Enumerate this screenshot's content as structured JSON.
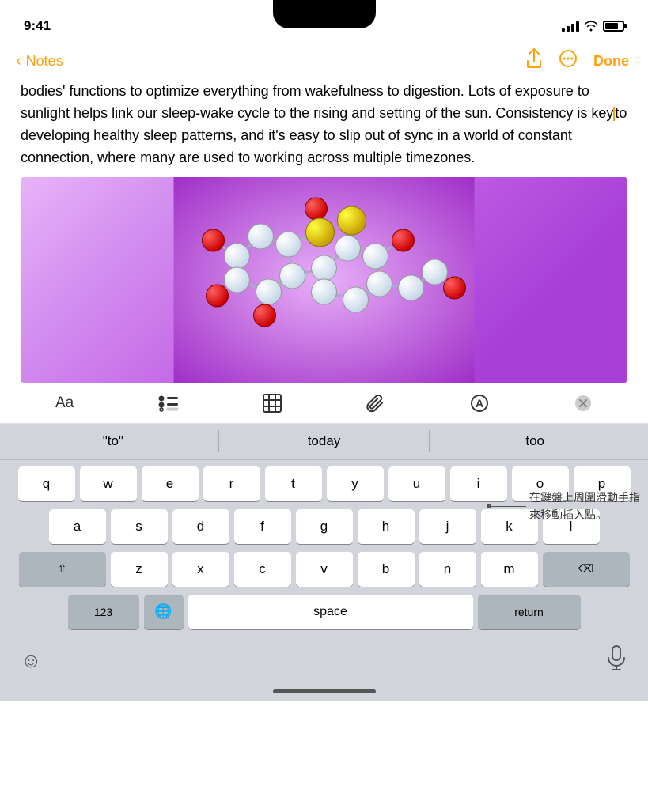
{
  "statusBar": {
    "time": "9:41",
    "signalBars": 4,
    "wifiLabel": "wifi",
    "batteryLevel": 75
  },
  "navBar": {
    "backLabel": "Notes",
    "shareIcon": "share",
    "moreIcon": "more",
    "doneLabel": "Done"
  },
  "noteContent": {
    "text": "bodies' functions to optimize everything from wakefulness to digestion. Lots of exposure to sunlight helps link our sleep-wake cycle to the rising and setting of the sun. Consistency is key",
    "text2": "to developing healthy sleep patterns, and it's easy to slip out of sync in a world of constant connection, where many are used to working across multiple timezones."
  },
  "formatToolbar": {
    "fontLabel": "Aa",
    "listIcon": "list",
    "tableIcon": "table",
    "attachIcon": "attach",
    "markupIcon": "markup",
    "closeIcon": "close"
  },
  "predictive": {
    "words": [
      "\"to\"",
      "today",
      "too"
    ]
  },
  "keyboard": {
    "rows": [
      [
        "q",
        "w",
        "e",
        "r",
        "t",
        "y",
        "u",
        "i",
        "o",
        "p"
      ],
      [
        "a",
        "s",
        "d",
        "f",
        "g",
        "h",
        "j",
        "k",
        "l"
      ],
      [
        "z",
        "x",
        "c",
        "v",
        "b",
        "n",
        "m"
      ]
    ],
    "spaceLabel": "space",
    "returnLabel": "return"
  },
  "bottomBar": {
    "emojiIcon": "emoji",
    "micIcon": "microphone"
  },
  "callout": {
    "text": "在鍵盤上周圍滑動手指\n來移動插入點。"
  }
}
